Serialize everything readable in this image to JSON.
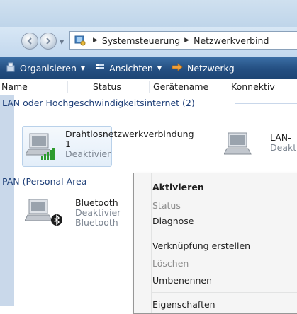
{
  "address": {
    "crumbs": [
      "Systemsteuerung",
      "Netzwerkverbind"
    ]
  },
  "toolbar": {
    "organize": "Organisieren",
    "views": "Ansichten",
    "network": "Netzwerkg"
  },
  "columns": [
    "Name",
    "Status",
    "Gerätename",
    "Konnektiv"
  ],
  "groups": [
    {
      "title": "LAN oder Hochgeschwindigkeitsinternet (2)",
      "items": [
        {
          "name": "Drahtlosnetzwerkverbindung",
          "name_line2": "1",
          "status": "Deaktivier"
        },
        {
          "name": "LAN-",
          "status": "Deakt"
        }
      ]
    },
    {
      "title": "PAN (Personal Area",
      "items": [
        {
          "name": "Bluetooth",
          "status": "Deaktivier",
          "device": "Bluetooth"
        }
      ]
    }
  ],
  "context_menu": {
    "items": [
      "Aktivieren",
      "Status",
      "Diagnose",
      "Verknüpfung erstellen",
      "Löschen",
      "Umbenennen",
      "Eigenschaften"
    ]
  },
  "colors": {
    "toolbar": "#244f82",
    "group_title": "#1e3f78",
    "disabled": "#8d8d8d"
  }
}
